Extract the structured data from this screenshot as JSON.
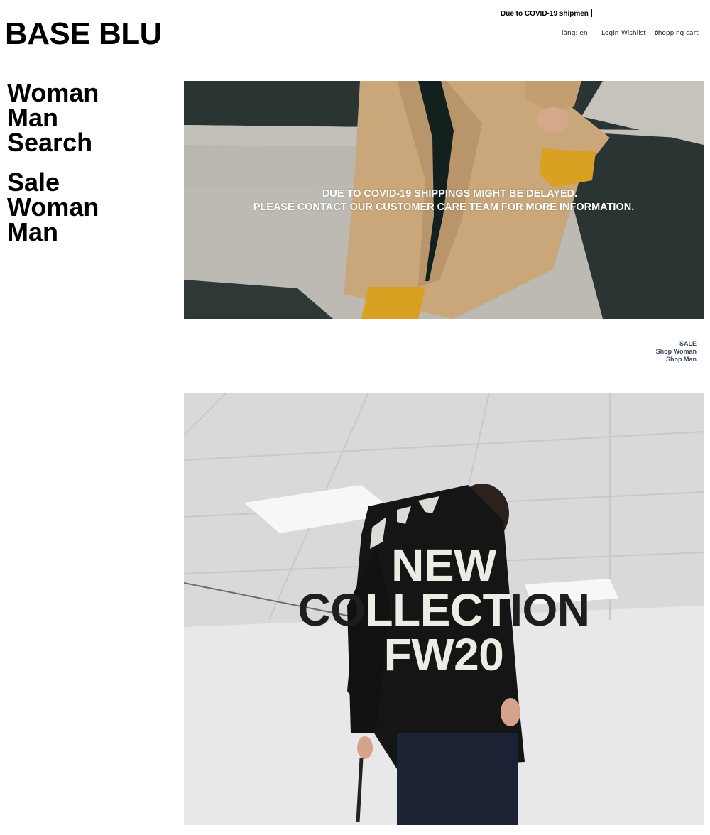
{
  "ticker": {
    "text": "Due to COVID-19 shipmen"
  },
  "logo": {
    "text": "BASE BLU"
  },
  "topnav": {
    "lang_label": "lang: en",
    "lang_chevron": "˅",
    "login": "Login",
    "wishlist": "Wishlist",
    "cart_label": "shopping cart",
    "cart_count": "0"
  },
  "sidebar": {
    "group1": [
      "Woman",
      "Man",
      "Search"
    ],
    "group2": [
      "Sale",
      "Woman",
      "Man"
    ]
  },
  "hero1": {
    "notice_line1": "DUE TO COVID-19 SHIPPINGS MIGHT BE DELAYED.",
    "notice_line2": "PLEASE CONTACT OUR CUSTOMER CARE TEAM FOR MORE INFORMATION."
  },
  "shop_links": [
    "SALE",
    "Shop Woman",
    "Shop Man"
  ],
  "hero2": {
    "line1": "NEW",
    "line2_dark_a": "CO",
    "line2_light": "LLECT",
    "line2_dark_b": "ION",
    "line3": "FW20"
  },
  "colors": {
    "background": "#ffffff",
    "text": "#000000",
    "shop_link": "#3b4a5e",
    "notice_text": "#ffffff"
  }
}
